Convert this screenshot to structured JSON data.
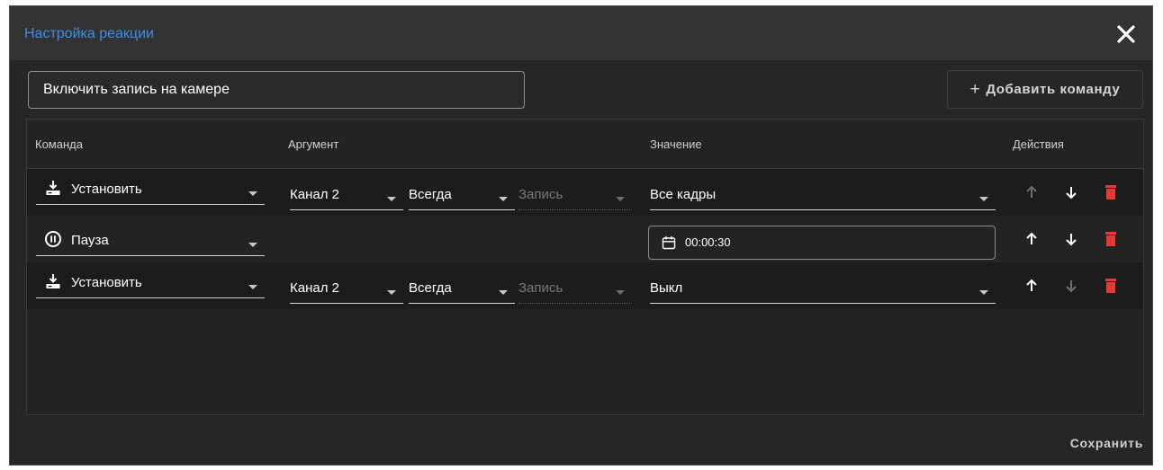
{
  "dialog": {
    "title": "Настройка реакции",
    "close_icon": "close-icon"
  },
  "name_input": {
    "value": "Включить запись на камере"
  },
  "add_command_button": {
    "icon": "plus-icon",
    "label": "Добавить команду"
  },
  "table": {
    "headers": {
      "command": "Команда",
      "argument": "Аргумент",
      "value": "Значение",
      "actions": "Действия"
    },
    "rows": [
      {
        "command": {
          "icon": "download-tray-icon",
          "label": "Установить"
        },
        "channel": "Канал 2",
        "mode": "Всегда",
        "target": "Запись",
        "value": "Все кадры",
        "actions": {
          "up_enabled": false,
          "down_enabled": true
        }
      },
      {
        "command": {
          "icon": "pause-circle-icon",
          "label": "Пауза"
        },
        "time": "00:00:30",
        "time_icon": "calendar-icon",
        "actions": {
          "up_enabled": true,
          "down_enabled": true
        }
      },
      {
        "command": {
          "icon": "download-tray-icon",
          "label": "Установить"
        },
        "channel": "Канал 2",
        "mode": "Всегда",
        "target": "Запись",
        "value": "Выкл",
        "actions": {
          "up_enabled": true,
          "down_enabled": false
        }
      }
    ]
  },
  "footer": {
    "save_label": "Сохранить"
  },
  "colors": {
    "accent": "#3d8ee8",
    "delete": "#e53935",
    "background": "#262626",
    "titlebar": "#333333"
  }
}
